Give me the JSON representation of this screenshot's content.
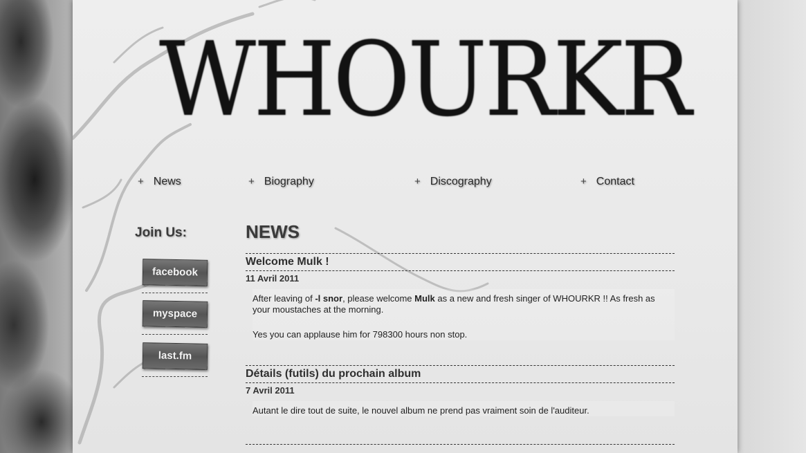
{
  "logo": {
    "text": "WHOURKR"
  },
  "nav": [
    {
      "label": "News"
    },
    {
      "label": "Biography"
    },
    {
      "label": "Discography"
    },
    {
      "label": "Contact"
    }
  ],
  "nav_plus": "+",
  "sidebar": {
    "join_title": "Join Us:",
    "social": [
      {
        "label": "facebook",
        "icon": "facebook-logo"
      },
      {
        "label": "myspace",
        "icon": "myspace-logo"
      },
      {
        "label": "last.fm",
        "icon": "lastfm-logo"
      }
    ]
  },
  "main": {
    "title": "NEWS",
    "articles": [
      {
        "title": "Welcome Mulk !",
        "date": "11 Avril 2011",
        "p1_a": "After leaving of ",
        "p1_b": "-l snor",
        "p1_c": ", please welcome ",
        "p1_d": "Mulk",
        "p1_e": " as a new and fresh singer of WHOURKR !! As fresh as your moustaches at the morning.",
        "p2": "Yes you can applause him for 798300 hours non stop."
      },
      {
        "title": "Détails (futils) du prochain album",
        "date": "7 Avril 2011",
        "p1": "Autant le dire tout de suite, le nouvel album ne prend pas vraiment soin de l'auditeur."
      }
    ]
  },
  "colors": {
    "page_bg": "#ececec",
    "text": "#222222",
    "logo": "#121212"
  }
}
